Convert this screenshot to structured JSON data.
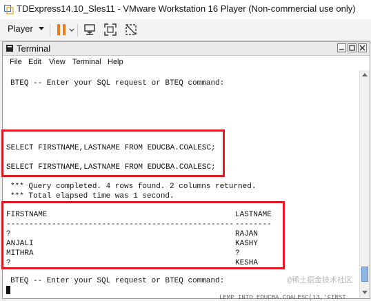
{
  "vm_window": {
    "title": "TDExpress14.10_Sles11 - VMware Workstation 16 Player (Non-commercial use only)",
    "logo_icon": "vmware-logo-icon"
  },
  "toolbar": {
    "player_label": "Player",
    "buttons": [
      "pause-icon",
      "send-ctrl-alt-del-icon",
      "fullscreen-icon",
      "unity-icon"
    ]
  },
  "terminal": {
    "title": "Terminal",
    "menu": [
      "File",
      "Edit",
      "View",
      "Terminal",
      "Help"
    ],
    "lines": {
      "prompt1": "BTEQ -- Enter your SQL request or BTEQ command:",
      "sql1": "SELECT FIRSTNAME,LASTNAME FROM EDUCBA.COALESC;",
      "sql2": "SELECT FIRSTNAME,LASTNAME FROM EDUCBA.COALESC;",
      "status1": "*** Query completed. 4 rows found. 2 columns returned.",
      "status2": "*** Total elapsed time was 1 second.",
      "prompt2": "BTEQ -- Enter your SQL request or BTEQ command:"
    },
    "result": {
      "columns": [
        "FIRSTNAME",
        "LASTNAME"
      ],
      "separator_left": "--------------------------------------------------",
      "separator_right": "--------",
      "rows": [
        [
          "?",
          "RAJAN"
        ],
        [
          "ANJALI",
          "KASHY"
        ],
        [
          "MITHRA",
          "?"
        ],
        [
          "?",
          "KESHA"
        ]
      ]
    }
  },
  "watermark": "@稀土掘金技术社区",
  "background_text": "LEMP INTO EDUCBA.COALESC(13,'FIRST"
}
